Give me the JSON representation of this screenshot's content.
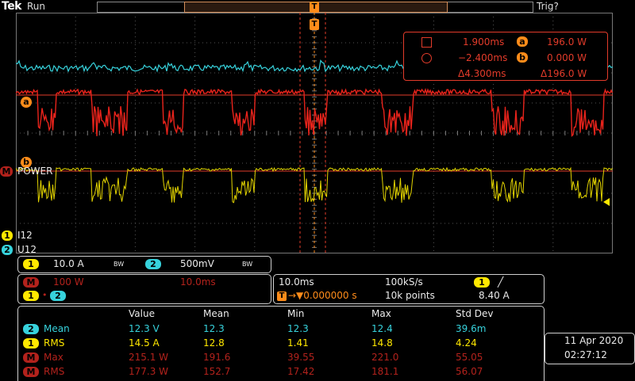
{
  "header": {
    "brand": "Tek",
    "run_status": "Run",
    "trigger_status": "Trig?"
  },
  "markers": {
    "trigger_T": "T",
    "cursor_a": "a",
    "cursor_b": "b",
    "math_M": "M",
    "power_label": "POWER",
    "ch1_number": "1",
    "ch1_label": "I12",
    "ch2_number": "2",
    "ch2_label": "U12"
  },
  "cursors": {
    "a_time": "1.900ms",
    "a_value": "196.0 W",
    "b_time": "−2.400ms",
    "b_value": "0.000 W",
    "delta_time": "Δ4.300ms",
    "delta_value": "Δ196.0 W"
  },
  "channels": {
    "ch1_num": "1",
    "ch1_scale": "10.0 A",
    "ch1_bw": "BW",
    "ch2_num": "2",
    "ch2_scale": "500mV",
    "ch2_bw": "BW"
  },
  "math": {
    "label": "M",
    "scale": "100 W",
    "time": "10.0ms",
    "source_a": "1",
    "source_b": "2"
  },
  "timebase": {
    "scale": "10.0ms",
    "sample_rate": "100kS/s",
    "trigger_chan": "1",
    "trigger_slope": "╱",
    "trigger_T": "T",
    "position": "→▼0.000000 s",
    "record_length": "10k points",
    "trigger_level": "8.40 A"
  },
  "measurements": {
    "headers": [
      "Value",
      "Mean",
      "Min",
      "Max",
      "Std Dev"
    ],
    "rows": [
      {
        "src": "2",
        "name": "Mean",
        "value": "12.3 V",
        "mean": "12.3",
        "min": "12.3",
        "max": "12.4",
        "std": "39.6m",
        "color": "#37d2dc"
      },
      {
        "src": "1",
        "name": "RMS",
        "value": "14.5 A",
        "mean": "12.8",
        "min": "1.41",
        "max": "14.8",
        "std": "4.24",
        "color": "#ffe800"
      },
      {
        "src": "M",
        "name": "Max",
        "value": "215.1 W",
        "mean": "191.6",
        "min": "39.55",
        "max": "221.0",
        "std": "55.05",
        "color": "#b3221c"
      },
      {
        "src": "M",
        "name": "RMS",
        "value": "177.3 W",
        "mean": "152.7",
        "min": "17.42",
        "max": "181.1",
        "std": "56.07",
        "color": "#b3221c"
      }
    ]
  },
  "datetime": {
    "date": "11 Apr  2020",
    "time": "02:27:12"
  },
  "colors": {
    "ch1": "#ffe800",
    "ch2": "#37d2dc",
    "math": "#e8231b",
    "cursor": "#e23b2a",
    "trigger": "#ff8c1a"
  }
}
